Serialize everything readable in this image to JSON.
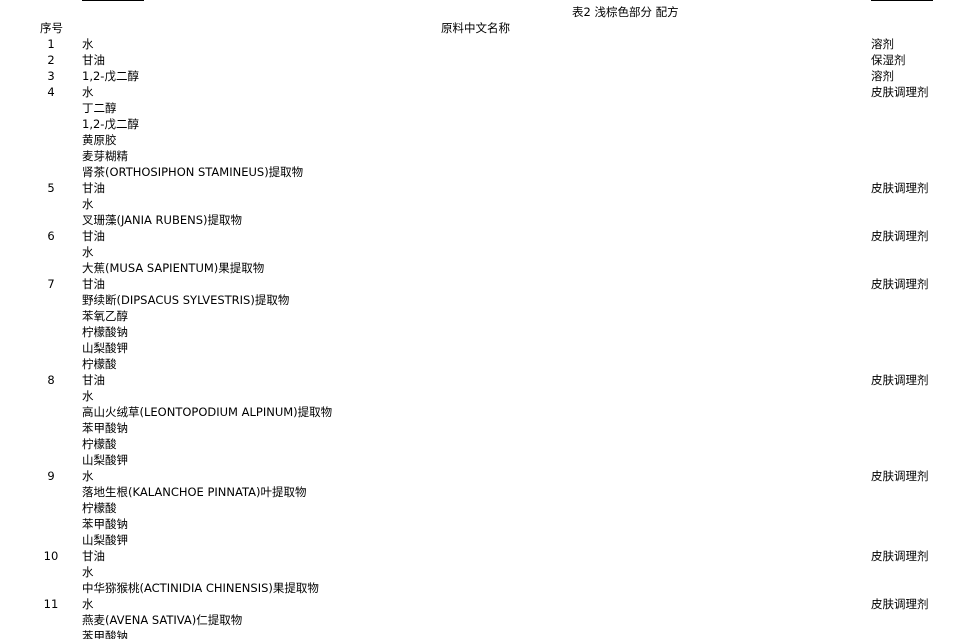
{
  "title": "表2 浅棕色部分 配方",
  "headers": {
    "seq": "序号",
    "name": "原料中文名称"
  },
  "rows": [
    {
      "no": "1",
      "fn": "溶剂",
      "items": [
        "水"
      ]
    },
    {
      "no": "2",
      "fn": "保湿剂",
      "items": [
        "甘油"
      ]
    },
    {
      "no": "3",
      "fn": "溶剂",
      "items": [
        "1,2-戊二醇"
      ]
    },
    {
      "no": "4",
      "fn": "皮肤调理剂",
      "items": [
        "水",
        "丁二醇",
        "1,2-戊二醇",
        "黄原胶",
        "麦芽糊精",
        "肾茶(ORTHOSIPHON STAMINEUS)提取物"
      ]
    },
    {
      "no": "5",
      "fn": "皮肤调理剂",
      "items": [
        "甘油",
        "水",
        "叉珊藻(JANIA RUBENS)提取物"
      ]
    },
    {
      "no": "6",
      "fn": "皮肤调理剂",
      "items": [
        "甘油",
        "水",
        "大蕉(MUSA SAPIENTUM)果提取物"
      ]
    },
    {
      "no": "7",
      "fn": "皮肤调理剂",
      "items": [
        "甘油",
        "野续断(DIPSACUS SYLVESTRIS)提取物",
        "苯氧乙醇",
        "柠檬酸钠",
        "山梨酸钾",
        "柠檬酸"
      ]
    },
    {
      "no": "8",
      "fn": "皮肤调理剂",
      "items": [
        "甘油",
        "水",
        "高山火绒草(LEONTOPODIUM ALPINUM)提取物",
        "苯甲酸钠",
        "柠檬酸",
        "山梨酸钾"
      ]
    },
    {
      "no": "9",
      "fn": "皮肤调理剂",
      "items": [
        "水",
        "落地生根(KALANCHOE PINNATA)叶提取物",
        "柠檬酸",
        "苯甲酸钠",
        "山梨酸钾"
      ]
    },
    {
      "no": "10",
      "fn": "皮肤调理剂",
      "items": [
        "甘油",
        "水",
        "中华猕猴桃(ACTINIDIA CHINENSIS)果提取物"
      ]
    },
    {
      "no": "11",
      "fn": "皮肤调理剂",
      "items": [
        "水",
        "燕麦(AVENA SATIVA)仁提取物",
        "苯甲酸钠"
      ]
    }
  ]
}
